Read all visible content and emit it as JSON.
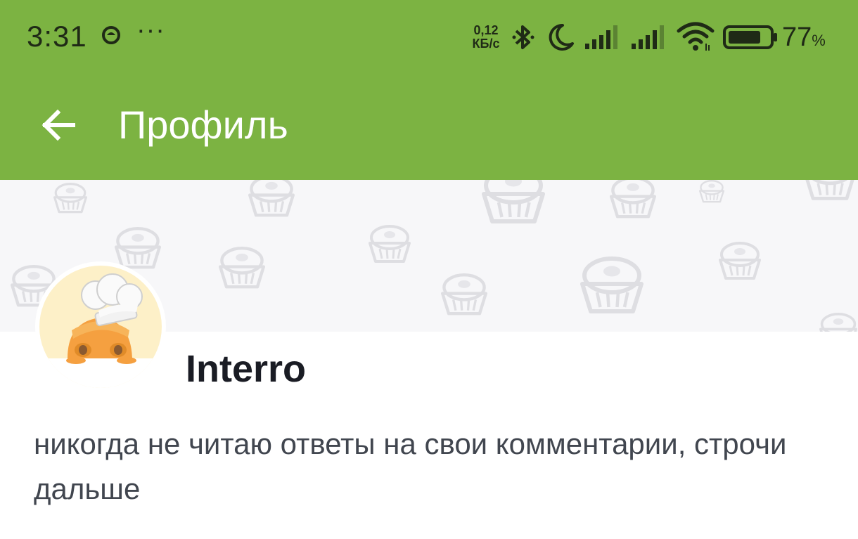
{
  "status_bar": {
    "time": "3:31",
    "more_indicator": "···",
    "net_speed_value": "0,12",
    "net_speed_unit": "КБ/с",
    "battery_percent": "77",
    "battery_percent_sign": "%",
    "icons": [
      "app-notification-icon",
      "bluetooth-icon",
      "do-not-disturb-moon-icon",
      "signal-sim1-icon",
      "signal-sim2-icon",
      "wifi-icon",
      "battery-icon"
    ]
  },
  "app_bar": {
    "title": "Профиль",
    "back_icon": "arrow-left-icon",
    "color": "#7cb342"
  },
  "profile": {
    "username": "Interro",
    "bio": "никогда не читаю ответы на свои комментарии, строчи дальше"
  },
  "banner": {
    "pattern_icon": "cupcake-icon",
    "background": "#f7f7f9"
  }
}
